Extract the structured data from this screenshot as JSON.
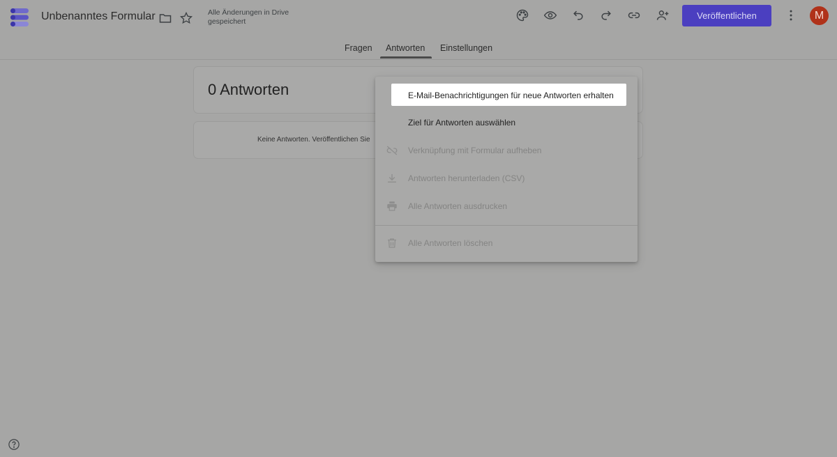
{
  "header": {
    "title": "Unbenanntes Formular",
    "save_status": "Alle Änderungen in Drive gespeichert",
    "publish_label": "Veröffentlichen",
    "avatar_initial": "M"
  },
  "tabs": [
    {
      "label": "Fragen",
      "active": false
    },
    {
      "label": "Antworten",
      "active": true
    },
    {
      "label": "Einstellungen",
      "active": false
    }
  ],
  "responses": {
    "count_label": "0 Antworten",
    "empty_message": "Keine Antworten. Veröffentlichen Sie"
  },
  "menu": {
    "items": [
      {
        "label": "E-Mail-Benachrichtigungen für neue Antworten erhalten",
        "enabled": true,
        "highlighted": true,
        "icon": "none"
      },
      {
        "label": "Ziel für Antworten auswählen",
        "enabled": true,
        "highlighted": false,
        "icon": "none"
      },
      {
        "label": "Verknüpfung mit Formular aufheben",
        "enabled": false,
        "highlighted": false,
        "icon": "link-off-icon"
      },
      {
        "label": "Antworten herunterladen (CSV)",
        "enabled": false,
        "highlighted": false,
        "icon": "download-icon"
      },
      {
        "label": "Alle Antworten ausdrucken",
        "enabled": false,
        "highlighted": false,
        "icon": "print-icon"
      },
      {
        "label": "Alle Antworten löschen",
        "enabled": false,
        "highlighted": false,
        "icon": "trash-icon"
      }
    ]
  },
  "colors": {
    "overlay_background": "#a6a6a5",
    "publish_button": "#4b3fc0",
    "avatar": "#b0321a",
    "menu_highlight": "#ffffff"
  }
}
